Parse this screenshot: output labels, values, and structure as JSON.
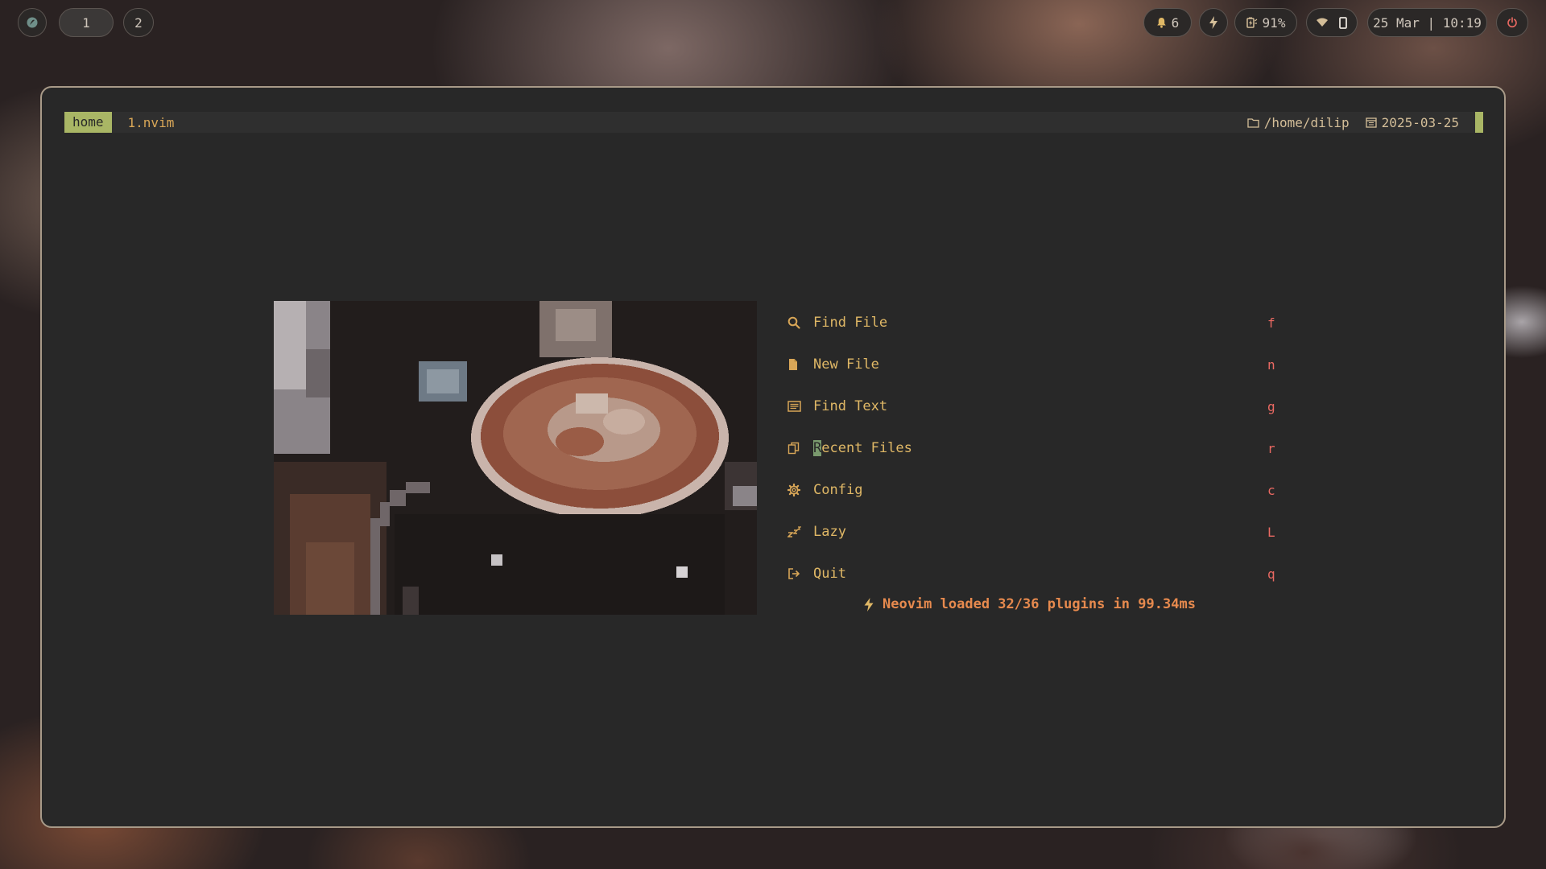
{
  "topbar": {
    "workspaces": [
      {
        "label": "1",
        "active": true
      },
      {
        "label": "2",
        "active": false
      }
    ],
    "notifications": "6",
    "battery": "91%",
    "datetime": "25 Mar | 10:19"
  },
  "tabline": {
    "home_tab": "home",
    "file_tab": "1.nvim",
    "path": "/home/dilip",
    "date": "2025-03-25"
  },
  "dashboard": {
    "items": [
      {
        "first": "F",
        "rest": "ind File",
        "key": "f",
        "icon": "search-icon"
      },
      {
        "first": "N",
        "rest": "ew File",
        "key": "n",
        "icon": "file-icon"
      },
      {
        "first": "F",
        "rest": "ind Text",
        "key": "g",
        "icon": "text-search-icon"
      },
      {
        "first": "R",
        "rest": "ecent Files",
        "key": "r",
        "icon": "copy-icon"
      },
      {
        "first": "C",
        "rest": "onfig",
        "key": "c",
        "icon": "gear-icon"
      },
      {
        "first": "L",
        "rest": "azy",
        "key": "L",
        "icon": "sleep-icon"
      },
      {
        "first": "Q",
        "rest": "uit",
        "key": "q",
        "icon": "logout-icon"
      }
    ],
    "selected_index": 3,
    "footer": "Neovim loaded 32/36 plugins in 99.34ms"
  },
  "colors": {
    "accent_green": "#a9b665",
    "accent_yellow": "#d8a657",
    "key_red": "#ea6962",
    "footer_orange": "#e78a4e",
    "window_bg": "#282828",
    "window_border": "#a89a88"
  }
}
